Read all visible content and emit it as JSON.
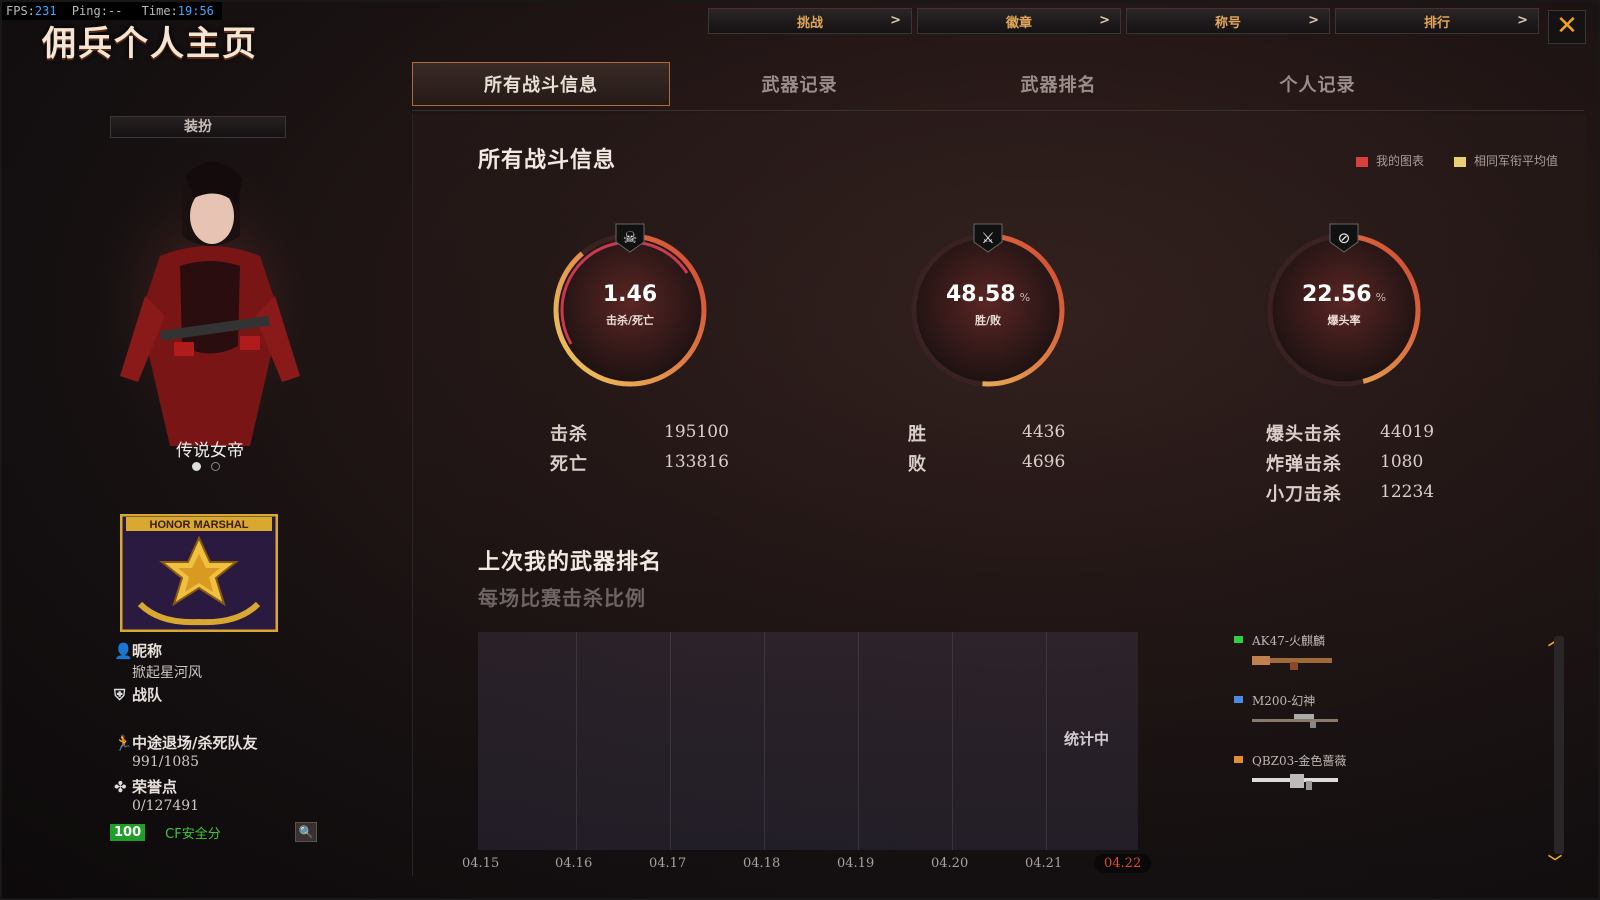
{
  "overlay": {
    "fps_label": "FPS:",
    "fps": "231",
    "ping_label": "Ping:",
    "ping": "--",
    "time_label": "Time:",
    "time": "19:56"
  },
  "header": {
    "title": "佣兵个人主页",
    "nav": [
      "挑战",
      "徽章",
      "称号",
      "排行"
    ]
  },
  "tabs": [
    "所有战斗信息",
    "武器记录",
    "武器排名",
    "个人记录"
  ],
  "sidebar": {
    "dress_button": "装扮",
    "character_name": "传说女帝",
    "badge_text": "HONOR MARSHAL",
    "nickname_label": "昵称",
    "nickname": "掀起星河风",
    "clan_label": "战队",
    "quit_label": "中途退场/杀死队友",
    "quit_value": "991/1085",
    "honor_label": "荣誉点",
    "honor_value": "0/127491",
    "safety_score": "100",
    "safety_label": "CF安全分"
  },
  "main": {
    "section_title": "所有战斗信息",
    "legend": [
      "我的图表",
      "相同军衔平均值"
    ],
    "gauges": [
      {
        "value": "1.46",
        "unit": "",
        "label": "击杀/死亡"
      },
      {
        "value": "48.58",
        "unit": "%",
        "label": "胜/败"
      },
      {
        "value": "22.56",
        "unit": "%",
        "label": "爆头率"
      }
    ],
    "stats": {
      "kills_label": "击杀",
      "kills": "195100",
      "deaths_label": "死亡",
      "deaths": "133816",
      "wins_label": "胜",
      "wins": "4436",
      "losses_label": "败",
      "losses": "4696",
      "headshot_label": "爆头击杀",
      "headshot": "44019",
      "bomb_label": "炸弹击杀",
      "bomb": "1080",
      "knife_label": "小刀击杀",
      "knife": "12234"
    },
    "weapon_section": {
      "title": "上次我的武器排名",
      "subtitle": "每场比赛击杀比例",
      "pending": "统计中",
      "dates": [
        "04.15",
        "04.16",
        "04.17",
        "04.18",
        "04.19",
        "04.20",
        "04.21",
        "04.22"
      ]
    },
    "weapons": [
      {
        "name": "AK47-火麒麟"
      },
      {
        "name": "M200-幻神"
      },
      {
        "name": "QBZ03-金色蔷薇"
      }
    ]
  },
  "colors": {
    "accent": "#e0a65a",
    "close": "#f0a21b",
    "legend_mine": "#d84040",
    "legend_avg": "#e8d070",
    "selected_date": "#e24a3a"
  }
}
